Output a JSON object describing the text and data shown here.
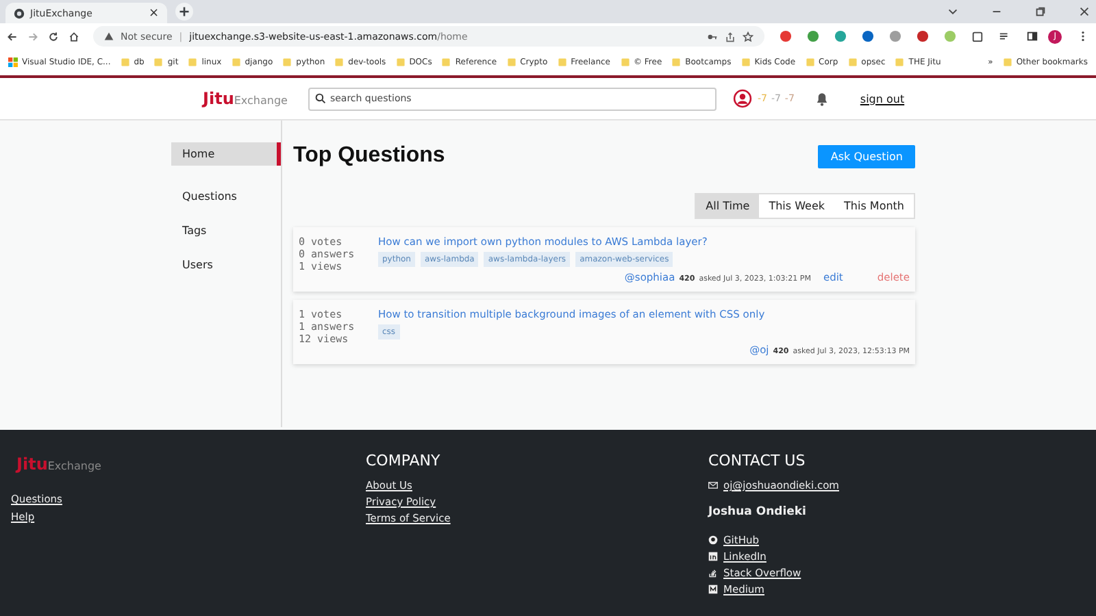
{
  "browser": {
    "tab": {
      "title": "JituExchange",
      "close": "×"
    },
    "address": {
      "security": "Not secure",
      "separator": "|",
      "host": "jituexchange.s3-website-us-east-1.amazonaws.com",
      "path": "/home"
    },
    "profile_letter": "J",
    "bookmarks": [
      "Visual Studio IDE, C...",
      "db",
      "git",
      "linux",
      "django",
      "python",
      "dev-tools",
      "DOCs",
      "Reference",
      "Crypto",
      "Freelance",
      "© Free",
      "Bootcamps",
      "Kids Code",
      "Corp",
      "opsec",
      "THE Jitu"
    ],
    "bookmarks_more": "»",
    "other_bookmarks": "Other bookmarks"
  },
  "header": {
    "logo": {
      "brand": "Jitu",
      "suffix": "Exchange"
    },
    "search": {
      "placeholder": "search questions"
    },
    "reputation": [
      {
        "text": "-7",
        "color": "#e8b84a"
      },
      {
        "text": "-7",
        "color": "#a8a8a8"
      },
      {
        "text": "-7",
        "color": "#c9a38a"
      }
    ],
    "sign_out": "sign out"
  },
  "sidebar": {
    "items": [
      {
        "label": "Home",
        "selected": true
      },
      {
        "label": "Questions",
        "selected": false
      },
      {
        "label": "Tags",
        "selected": false
      },
      {
        "label": "Users",
        "selected": false
      }
    ]
  },
  "main": {
    "title": "Top Questions",
    "ask_button": "Ask Question",
    "filters": [
      {
        "label": "All Time",
        "selected": true
      },
      {
        "label": "This Week",
        "selected": false
      },
      {
        "label": "This Month",
        "selected": false
      }
    ],
    "questions": [
      {
        "votes": "0 votes",
        "answers": "0 answers",
        "views": "1 views",
        "title": "How can we import own python modules to AWS Lambda layer?",
        "tags": [
          "python",
          "aws-lambda",
          "aws-lambda-layers",
          "amazon-web-services"
        ],
        "user": "@sophiaa",
        "rep": "420",
        "asked": "asked Jul 3, 2023, 1:03:21 PM",
        "actions": [
          "edit",
          "delete"
        ]
      },
      {
        "votes": "1 votes",
        "answers": "1 answers",
        "views": "12 views",
        "title": "How to transition multiple background images of an element with CSS only",
        "tags": [
          "css"
        ],
        "user": "@oj",
        "rep": "420",
        "asked": "asked Jul 3, 2023, 12:53:13 PM"
      }
    ]
  },
  "footer": {
    "logo": {
      "brand": "Jitu",
      "suffix": "Exchange"
    },
    "links": [
      "Questions",
      "Help"
    ],
    "company": {
      "heading": "COMPANY",
      "links": [
        "About Us",
        "Privacy Policy",
        "Terms of Service"
      ]
    },
    "contact": {
      "heading": "CONTACT US",
      "email": "oj@joshuaondieki.com",
      "name": "Joshua Ondieki",
      "social": [
        {
          "kind": "github",
          "label": "GitHub"
        },
        {
          "kind": "linkedin",
          "label": "LinkedIn"
        },
        {
          "kind": "stackoverflow",
          "label": "Stack Overflow"
        },
        {
          "kind": "medium",
          "label": "Medium"
        }
      ]
    }
  }
}
